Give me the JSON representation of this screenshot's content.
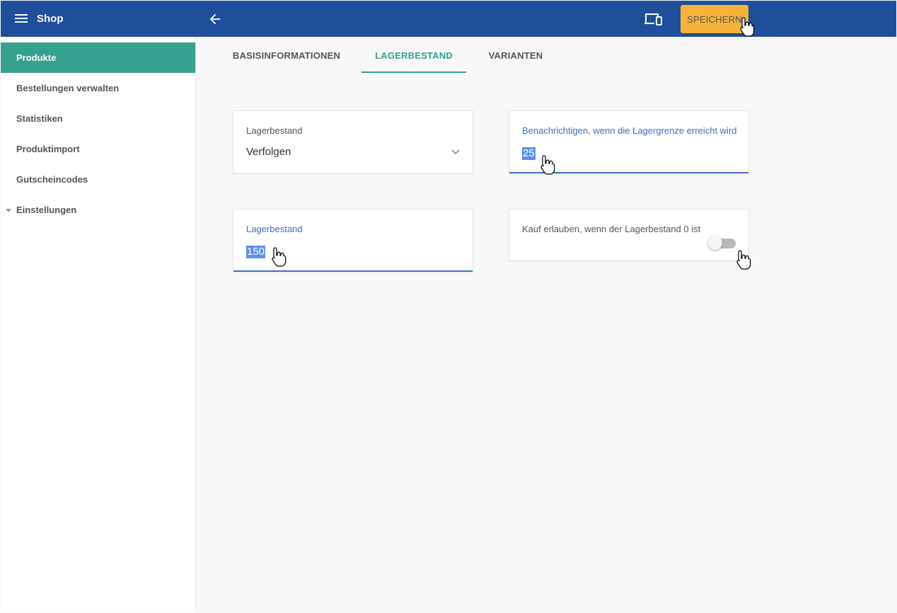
{
  "header": {
    "app_title": "Shop",
    "menu_icon": "hamburger-menu-icon",
    "back_icon": "arrow-left-icon",
    "preview_icon": "devices-icon",
    "save_label": "SPEICHERN",
    "save_color": "#f7b239",
    "bar_color": "#1f4f9a"
  },
  "sidebar": {
    "items": [
      {
        "label": "Produkte",
        "active": true
      },
      {
        "label": "Bestellungen verwalten"
      },
      {
        "label": "Statistiken"
      },
      {
        "label": "Produktimport"
      },
      {
        "label": "Gutscheincodes"
      },
      {
        "label": "Einstellungen",
        "collapsible": true
      }
    ],
    "active_color": "#36a08f"
  },
  "tabs": {
    "items": [
      {
        "label": "BASISINFORMATIONEN"
      },
      {
        "label": "LAGERBESTAND",
        "active": true
      },
      {
        "label": "VARIANTEN"
      }
    ]
  },
  "form": {
    "tracking": {
      "label": "Lagerbestand",
      "value": "Verfolgen"
    },
    "notify": {
      "label": "Benachrichtigen, wenn die Lagergrenze erreicht wird",
      "value": "25"
    },
    "stock": {
      "label": "Lagerbestand",
      "value": "150"
    },
    "allow_purchase": {
      "label": "Kauf erlauben, wenn der Lagerbestand 0 ist",
      "enabled": false
    }
  }
}
